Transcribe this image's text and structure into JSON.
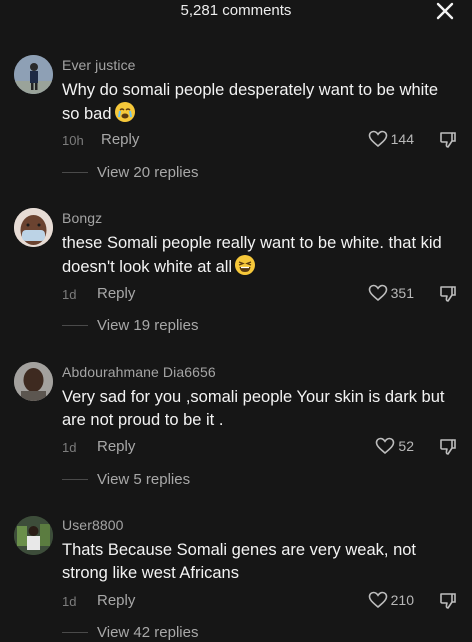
{
  "header": {
    "title": "5,281 comments"
  },
  "comments": [
    {
      "username": "Ever justice",
      "text": "Why do somali people desperately want to be white so bad",
      "emoji": "crying-face",
      "time": "10h",
      "reply_label": "Reply",
      "likes": "144",
      "view_replies": "View 20 replies"
    },
    {
      "username": "Bongz",
      "text": "these Somali people really want to be white. that kid doesn't look white at all",
      "emoji": "laughing-face",
      "time": "1d",
      "reply_label": "Reply",
      "likes": "351",
      "view_replies": "View 19 replies"
    },
    {
      "username": "Abdourahmane Dia6656",
      "text": "Very sad for you ,somali people Your skin is dark but are not proud to be it .",
      "time": "1d",
      "reply_label": "Reply",
      "likes": "52",
      "view_replies": "View 5 replies"
    },
    {
      "username": "User8800",
      "text": "Thats Because Somali genes are very weak, not strong like west Africans",
      "time": "1d",
      "reply_label": "Reply",
      "likes": "210",
      "view_replies": "View 42 replies"
    }
  ],
  "colors": {
    "background": "#161616",
    "secondary_text": "#a8a8a8",
    "emoji": "#f6c83a"
  }
}
